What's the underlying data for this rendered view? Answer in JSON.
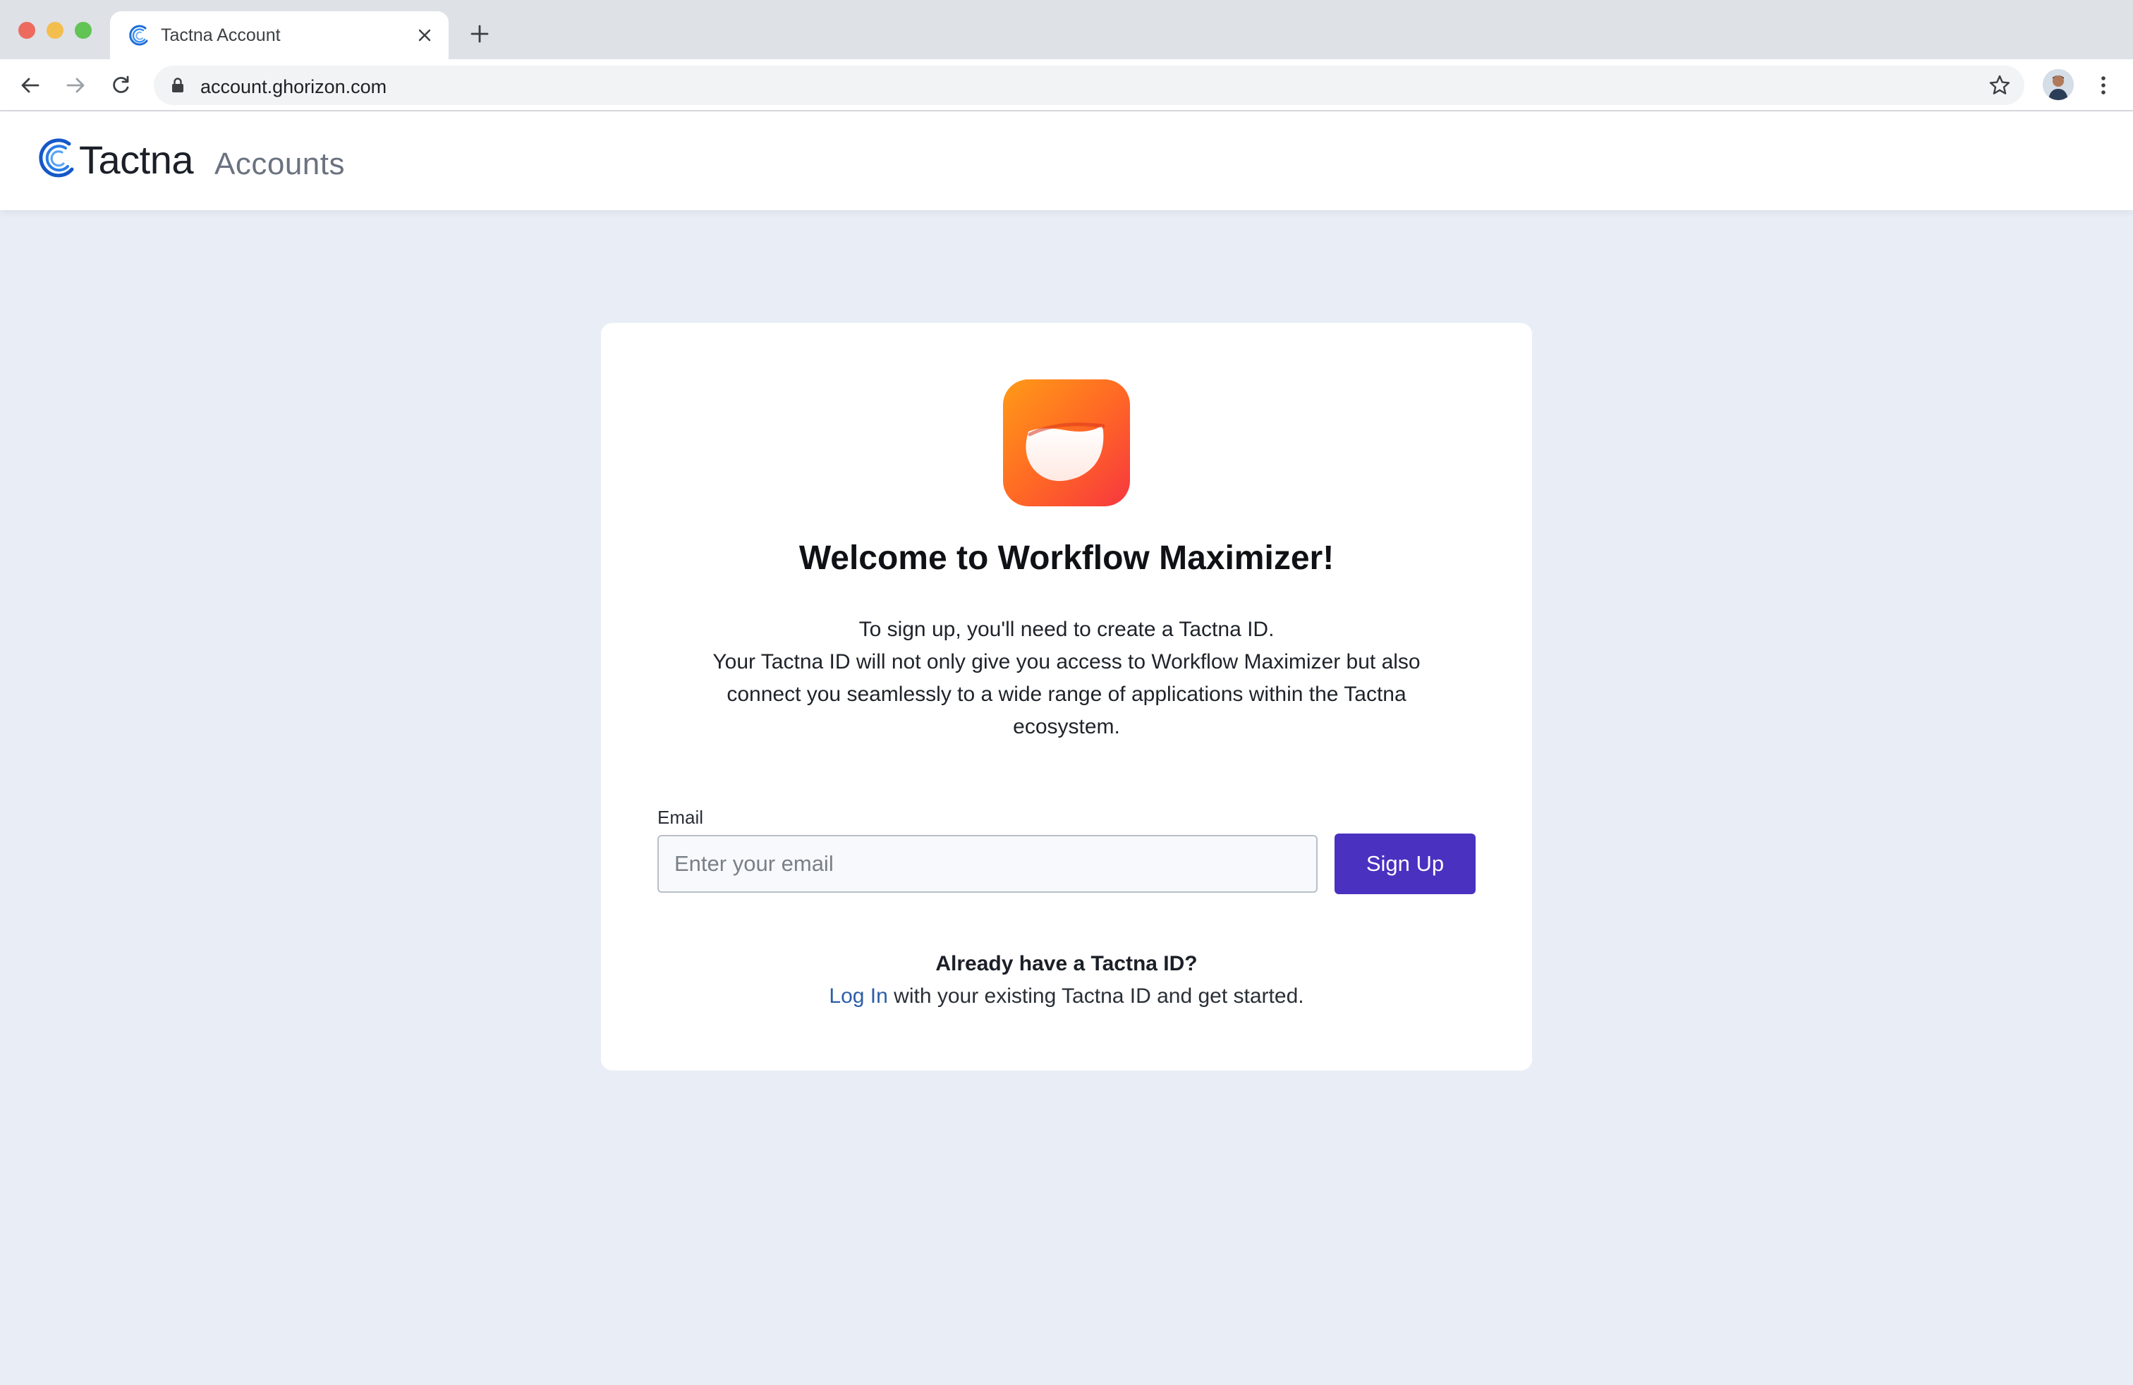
{
  "browser": {
    "tab_title": "Tactna Account",
    "url": "account.ghorizon.com",
    "icons": [
      "close-icon",
      "plus-icon",
      "back-arrow-icon",
      "forward-arrow-icon",
      "reload-icon",
      "lock-icon",
      "star-icon",
      "kebab-menu-icon"
    ]
  },
  "header": {
    "brand_name": "Tactna",
    "brand_sub": "Accounts"
  },
  "card": {
    "welcome_title": "Welcome to Workflow Maximizer!",
    "description_line1": "To sign up, you'll need to create a Tactna ID.",
    "description_line2": "Your Tactna ID will not only give you access to Workflow Maximizer but also connect you seamlessly to a wide range of applications within the Tactna ecosystem.",
    "email_label": "Email",
    "email_placeholder": "Enter your email",
    "email_value": "",
    "signup_button": "Sign Up",
    "already_text": "Already have a Tactna ID?",
    "login_link": "Log In",
    "login_suffix": " with your existing Tactna ID and get started."
  },
  "colors": {
    "primary_button": "#4a31c0",
    "link": "#2b5ea7",
    "page_bg": "#e9eef6",
    "app_icon_gradient": [
      "#ff9a17",
      "#f7363f"
    ]
  }
}
